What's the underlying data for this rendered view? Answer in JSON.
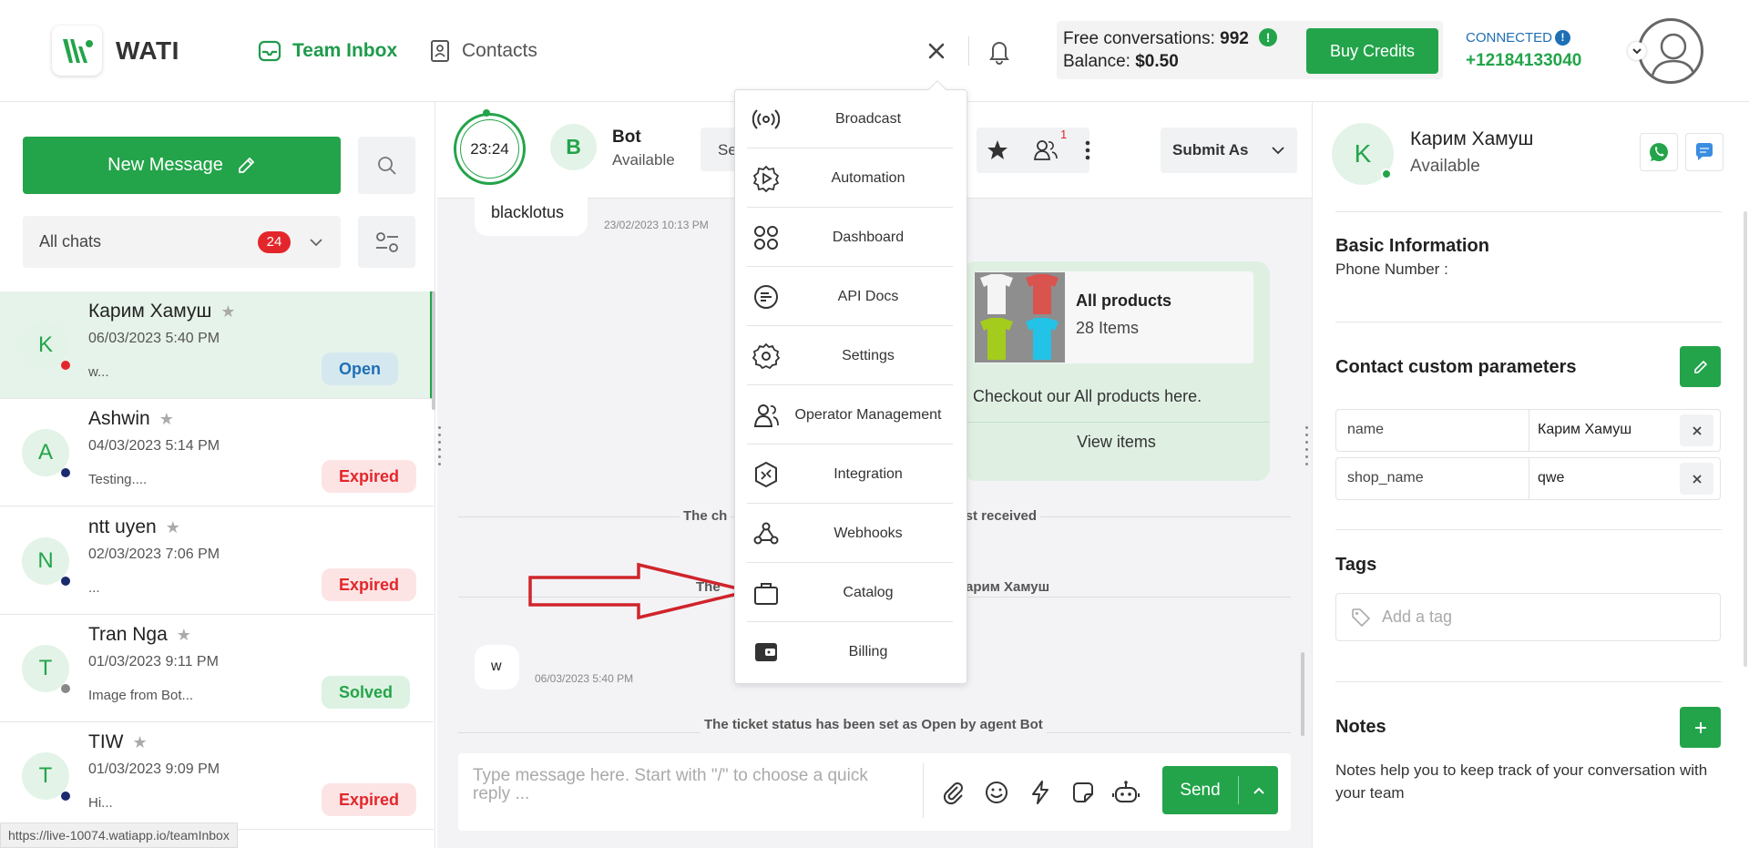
{
  "app": {
    "logo_text": "WATI"
  },
  "nav": {
    "team_inbox": "Team Inbox",
    "contacts": "Contacts"
  },
  "credits": {
    "free_label": "Free conversations:",
    "free_value": "992",
    "balance_label": "Balance:",
    "balance_value": "$0.50",
    "info_glyph": "!",
    "buy_label": "Buy Credits"
  },
  "connection": {
    "status": "CONNECTED",
    "info_glyph": "!",
    "phone": "+12184133040"
  },
  "left": {
    "new_message": "New Message",
    "filter_label": "All chats",
    "filter_count": "24",
    "chats": [
      {
        "initial": "K",
        "name": "Карим Хамуш",
        "date": "06/03/2023 5:40 PM",
        "preview": "w...",
        "status": "Open",
        "dot": "#e3262b"
      },
      {
        "initial": "A",
        "name": "Ashwin",
        "date": "04/03/2023 5:14 PM",
        "preview": "Testing....",
        "status": "Expired",
        "dot": "#1a2a6c"
      },
      {
        "initial": "N",
        "name": "ntt uyen",
        "date": "02/03/2023 7:06 PM",
        "preview": "...",
        "status": "Expired",
        "dot": "#1a2a6c"
      },
      {
        "initial": "T",
        "name": "Tran Nga",
        "date": "01/03/2023 9:11 PM",
        "preview": "Image from Bot...",
        "status": "Solved",
        "dot": "#888888"
      },
      {
        "initial": "T",
        "name": "TIW",
        "date": "01/03/2023 9:09 PM",
        "preview": "Hi...",
        "status": "Expired",
        "dot": "#1a2a6c"
      }
    ],
    "status_url": "https://live-10074.watiapp.io/teamInbox"
  },
  "chat_header": {
    "timer": "23:24",
    "assignee_initial": "B",
    "assignee_name": "Bot",
    "assignee_status": "Available",
    "select_partial": "Se",
    "notification_count": "1",
    "submit_as": "Submit As"
  },
  "messages": {
    "m1_text": "blacklotus",
    "m1_time": "23/02/2023 10:13 PM",
    "product_title": "All products",
    "product_count": "28 Items",
    "product_caption": "Checkout our All products here.",
    "product_button": "View items",
    "sys1_left": "The ch",
    "sys1_right": "f last received",
    "sys2_left": "The",
    "sys2_right": "арим Хамуш",
    "m2_text": "w",
    "m2_time": "06/03/2023 5:40 PM",
    "sys3": "The ticket status has been set as Open by agent Bot"
  },
  "composer": {
    "placeholder": "Type message here. Start with \"/\" to choose a quick reply ...",
    "send": "Send"
  },
  "dropdown": {
    "items": [
      {
        "label": "Broadcast",
        "icon": "broadcast-icon"
      },
      {
        "label": "Automation",
        "icon": "automation-icon"
      },
      {
        "label": "Dashboard",
        "icon": "dashboard-icon"
      },
      {
        "label": "API Docs",
        "icon": "api-docs-icon"
      },
      {
        "label": "Settings",
        "icon": "settings-icon"
      },
      {
        "label": "Operator Management",
        "icon": "operators-icon"
      },
      {
        "label": "Integration",
        "icon": "integration-icon"
      },
      {
        "label": "Webhooks",
        "icon": "webhooks-icon"
      },
      {
        "label": "Catalog",
        "icon": "catalog-icon"
      },
      {
        "label": "Billing",
        "icon": "billing-icon"
      }
    ]
  },
  "contact": {
    "initial": "K",
    "name": "Карим Хамуш",
    "status": "Available",
    "basic_info_title": "Basic Information",
    "phone_label": "Phone Number :",
    "custom_params_title": "Contact custom parameters",
    "params": [
      {
        "key": "name",
        "value": "Карим Хамуш"
      },
      {
        "key": "shop_name",
        "value": "qwe"
      }
    ],
    "tags_title": "Tags",
    "tag_placeholder": "Add a tag",
    "notes_title": "Notes",
    "notes_text": "Notes help you to keep track of your conversation with your team"
  },
  "colors": {
    "brand_green": "#23a44a",
    "connected_blue": "#1f6fb5",
    "alert_red": "#e3262b",
    "annotation_arrow": "#d0242b"
  }
}
